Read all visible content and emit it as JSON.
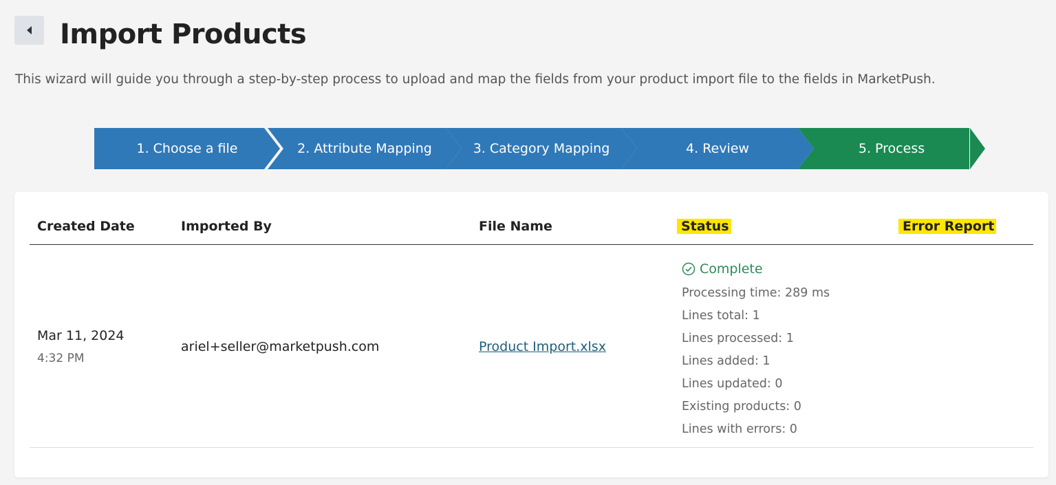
{
  "header": {
    "back_icon": "caret-left-icon",
    "title": "Import Products",
    "subtitle": "This wizard will guide you through a step-by-step process to upload and map the fields from your product import file to the fields in MarketPush."
  },
  "steps": [
    {
      "label": "1. Choose a file",
      "state": "completed"
    },
    {
      "label": "2. Attribute Mapping",
      "state": "completed"
    },
    {
      "label": "3. Category Mapping",
      "state": "completed"
    },
    {
      "label": "4. Review",
      "state": "completed"
    },
    {
      "label": "5. Process",
      "state": "active"
    }
  ],
  "colors": {
    "step_blue": "#3079b8",
    "step_green": "#1a8a52",
    "highlight": "#ffe600",
    "status_green": "#2e8b57",
    "link": "#1d5e78"
  },
  "table": {
    "headers": {
      "created_date": "Created Date",
      "imported_by": "Imported By",
      "file_name": "File Name",
      "status": "Status",
      "error_report": "Error Report"
    },
    "row": {
      "date": "Mar 11, 2024",
      "time": "4:32 PM",
      "imported_by": "ariel+seller@marketpush.com",
      "file_name": "Product Import.xlsx",
      "status_icon": "check-circle-icon",
      "status": "Complete",
      "processing_time": "Processing time: 289 ms",
      "lines_total": "Lines total: 1",
      "lines_processed": "Lines processed: 1",
      "lines_added": "Lines added: 1",
      "lines_updated": "Lines updated: 0",
      "existing_products": "Existing products: 0",
      "lines_with_errors": "Lines with errors: 0"
    }
  }
}
